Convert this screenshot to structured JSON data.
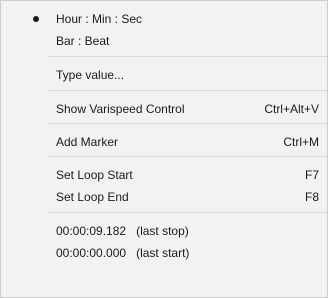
{
  "menu": {
    "items": [
      {
        "label": "Hour : Min : Sec",
        "checked": true
      },
      {
        "label": "Bar : Beat"
      },
      {
        "label": "Type value..."
      },
      {
        "label": "Show Varispeed Control",
        "shortcut": "Ctrl+Alt+V"
      },
      {
        "label": "Add Marker",
        "shortcut": "Ctrl+M"
      },
      {
        "label": "Set Loop Start",
        "shortcut": "F7"
      },
      {
        "label": "Set Loop End",
        "shortcut": "F8"
      },
      {
        "label": "00:00:09.182   (last stop)"
      },
      {
        "label": "00:00:00.000   (last start)"
      }
    ]
  }
}
